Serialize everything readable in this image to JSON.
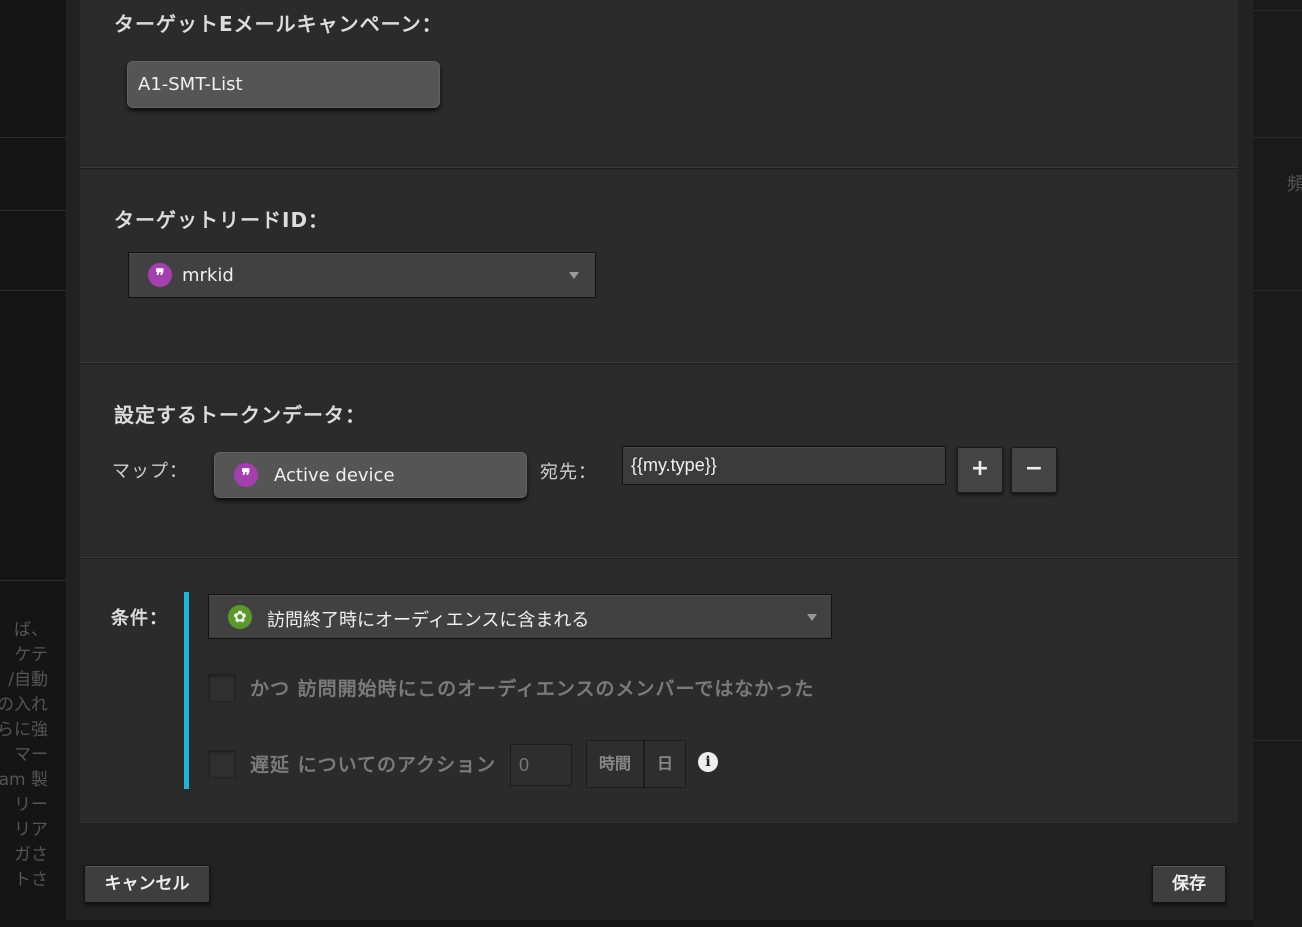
{
  "background": {
    "left_fragments": [
      "ば、",
      "ケテ",
      "/自動",
      "の入れ",
      "らに強",
      "マー",
      "am 製",
      "リー",
      "リア",
      "ガさ",
      "トさ"
    ],
    "right_fragment": "頻"
  },
  "sections": {
    "campaign": {
      "title": "ターゲットEメールキャンペーン：",
      "value": "A1-SMT-List"
    },
    "lead_id": {
      "title": "ターゲットリードID：",
      "token_icon": "quote-token-icon",
      "value": "mrkid"
    },
    "token_data": {
      "title": "設定するトークンデータ：",
      "map_label": "マップ：",
      "map_value": "Active device",
      "to_label": "宛先：",
      "to_value": "{{my.type}}",
      "add_label": "+",
      "remove_label": "−"
    },
    "condition": {
      "label": "条件：",
      "select_value": "訪問終了時にオーディエンスに含まれる",
      "and_not_member_text": "かつ 訪問開始時にこのオーディエンスのメンバーではなかった",
      "delay_text": "遅延 についてのアクション",
      "delay_value": "0",
      "unit_hours": "時間",
      "unit_days": "日",
      "info_icon": "i"
    }
  },
  "footer": {
    "cancel_label": "キャンセル",
    "save_label": "保存"
  },
  "colors": {
    "accent_bar": "#1fb7d8",
    "token_icon": "#a53fb0",
    "condition_icon": "#5a9a2a"
  }
}
